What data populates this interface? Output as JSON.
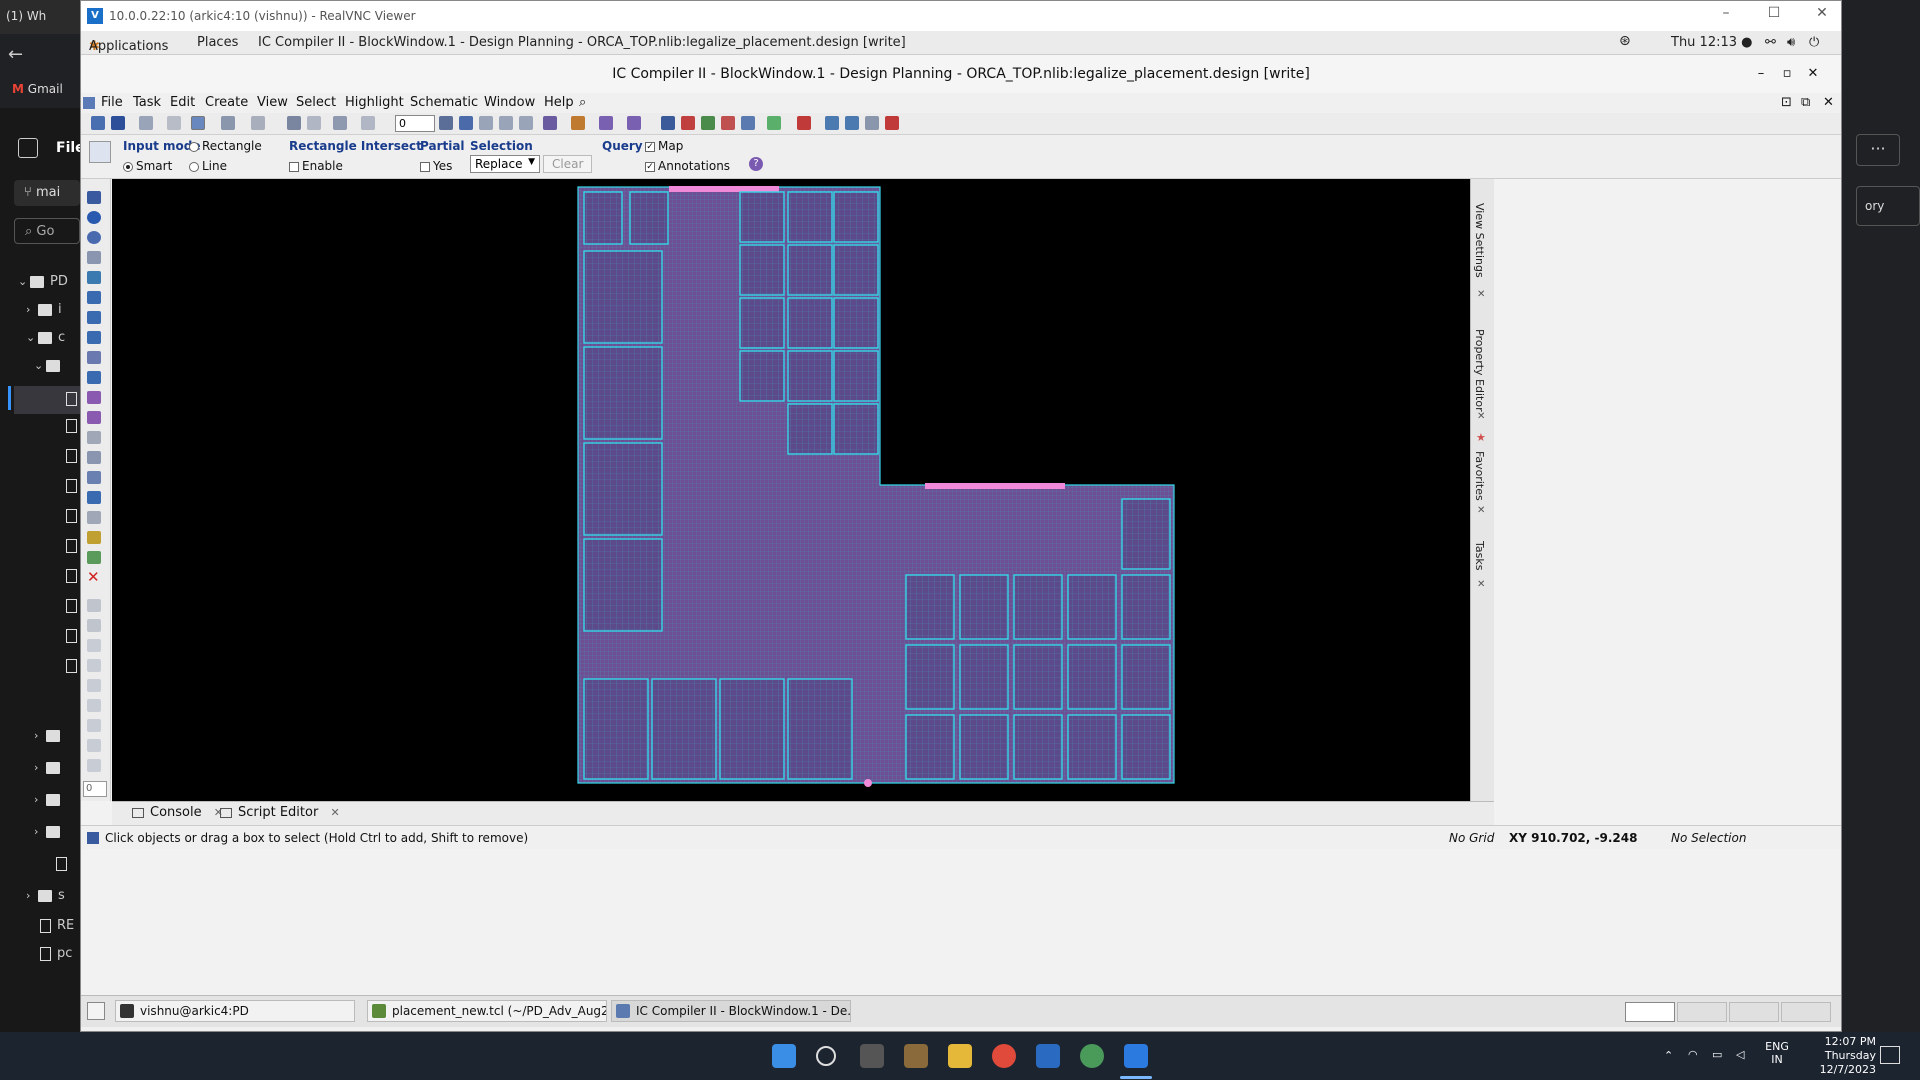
{
  "host": {
    "tab_title": "(1) Wh",
    "gmail_label": "Gmail",
    "sidebar_title": "File",
    "branch_label": "mai",
    "search_label": "Go",
    "rows": [
      "PD",
      "i",
      "c",
      "",
      "",
      "",
      "",
      "",
      "",
      "",
      "",
      "",
      "",
      "",
      "",
      "",
      "",
      "",
      "s",
      "RE",
      "pc"
    ],
    "right_label": "ory"
  },
  "vnc": {
    "title": "10.0.0.22:10 (arkic4:10 (vishnu)) - RealVNC Viewer"
  },
  "gnome": {
    "applications": "Applications",
    "places": "Places",
    "app_title": "IC Compiler II - BlockWindow.1 - Design Planning - ORCA_TOP.nlib:legalize_placement.design [write]",
    "clock": "Thu 12:13 ●"
  },
  "ic": {
    "title": "IC Compiler II - BlockWindow.1 - Design Planning - ORCA_TOP.nlib:legalize_placement.design [write]",
    "menu": [
      "File",
      "Task",
      "Edit",
      "Create",
      "View",
      "Select",
      "Highlight",
      "Schematic",
      "Window",
      "Help"
    ],
    "toolbar_value": "0",
    "options": {
      "input_mode": "Input mode",
      "smart": "Smart",
      "rectangle": "Rectangle",
      "line": "Line",
      "rect_intersect": "Rectangle Intersect",
      "enable": "Enable",
      "partial": "Partial",
      "yes": "Yes",
      "selection": "Selection",
      "replace": "Replace",
      "clear": "Clear",
      "query": "Query",
      "map": "Map",
      "annotations": "Annotations"
    },
    "left_value": "0",
    "right_tabs": [
      "View Settings",
      "Property Editor",
      "Favorites",
      "Tasks"
    ],
    "console_tabs": [
      "Console",
      "Script Editor"
    ],
    "status": {
      "hint": "Click objects or drag a box to select (Hold Ctrl to add, Shift to remove)",
      "grid": "No Grid",
      "xy": "XY 910.702, -9.248",
      "selection": "No Selection"
    }
  },
  "gtask": {
    "items": [
      "vishnu@arkic4:PD",
      "placement_new.tcl (~/PD_Adv_Aug2...",
      "IC Compiler II - BlockWindow.1 - De..."
    ]
  },
  "win": {
    "lang1": "ENG",
    "lang2": "IN",
    "time": "12:07 PM",
    "day": "Thursday",
    "date": "12/7/2023"
  },
  "colors": {
    "canvas_bg": "#000000",
    "block_fill": "#7a5a9a",
    "macro_outline": "#34d8e8",
    "pin_pink": "#f08ad8",
    "header_blue": "#1a3c8c"
  }
}
